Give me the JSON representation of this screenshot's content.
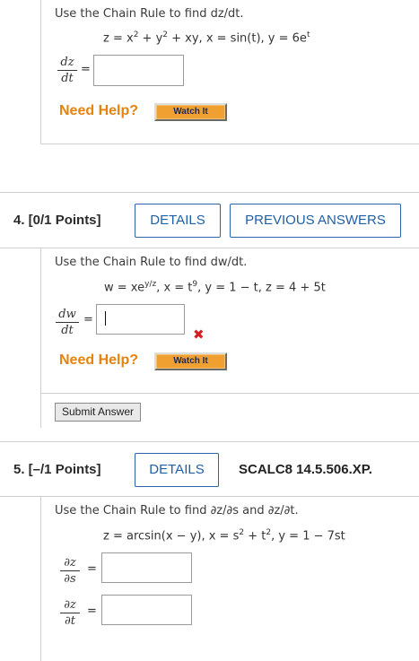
{
  "q3": {
    "instruction": "Use the Chain Rule to find dz/dt.",
    "equation_parts": [
      "z = x",
      "2",
      " + y",
      "2",
      " + xy,   x = sin(t),   y = 6e",
      "t"
    ],
    "frac_num": "dz",
    "frac_den": "dt",
    "equals": "=",
    "need_help": "Need Help?",
    "watch": "Watch It"
  },
  "q4": {
    "header": "4.  [0/1 Points]",
    "details": "DETAILS",
    "previous_answers": "PREVIOUS ANSWERS",
    "instruction": "Use the Chain Rule to find dw/dt.",
    "eq_w": "w = xe",
    "eq_w_sup": "y/z",
    "eq_x": ",   x = t",
    "eq_x_sup": "9",
    "eq_rest": ",   y = 1 − t,   z = 4 + 5t",
    "frac_num": "dw",
    "frac_den": "dt",
    "equals": "=",
    "answer_value": "",
    "incorrect_icon": "x-mark-icon",
    "need_help": "Need Help?",
    "watch": "Watch It",
    "submit": "Submit Answer"
  },
  "q5": {
    "header": "5.  [–/1 Points]",
    "details": "DETAILS",
    "code": "SCALC8 14.5.506.XP.",
    "instruction": "Use the Chain Rule to find ∂z/∂s and ∂z/∂t.",
    "eq_a": "z = arcsin(x − y),   x = s",
    "eq_a_sup": "2",
    "eq_b": " + t",
    "eq_b_sup": "2",
    "eq_c": ",   y = 1 − 7st",
    "frac1_num": "∂z",
    "frac1_den": "∂s",
    "frac2_num": "∂z",
    "frac2_den": "∂t",
    "equals": "="
  },
  "colors": {
    "accent_blue": "#1f5fa6",
    "need_help_orange": "#e6820e",
    "watch_bg": "#f0a030",
    "error_red": "#d32020"
  }
}
